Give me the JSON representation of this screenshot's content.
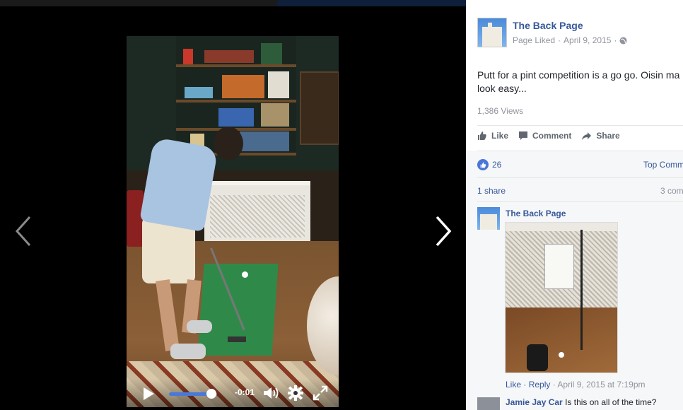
{
  "viewer": {
    "video": {
      "elapsed_fraction": 0.88,
      "time_label": "-0:01"
    },
    "prev_label": "Previous",
    "next_label": "Next"
  },
  "post": {
    "page_name": "The Back Page",
    "meta_status": "Page Liked",
    "meta_date": "April 9, 2015",
    "meta_separator": "·",
    "privacy_icon": "globe-icon",
    "text_line1": "Putt for a pint competition is a go go. Oisin ma",
    "text_line2": "look easy...",
    "views": "1,386 Views",
    "actions": {
      "like": "Like",
      "comment": "Comment",
      "share": "Share"
    },
    "reaction_count": "26",
    "top_comments": "Top Comm",
    "shares": "1 share",
    "comments_count": "3 com"
  },
  "comments": [
    {
      "author": "The Back Page",
      "like": "Like",
      "reply": "Reply",
      "separator": "·",
      "date": "April 9, 2015 at 7:19pm"
    },
    {
      "author": "Jamie Jay Car",
      "text": " Is this on all of the time?"
    }
  ],
  "colors": {
    "link": "#365899",
    "muted": "#90949c",
    "text": "#1d2129",
    "like_blue": "#4a76d6",
    "progress": "#4a78d6"
  }
}
